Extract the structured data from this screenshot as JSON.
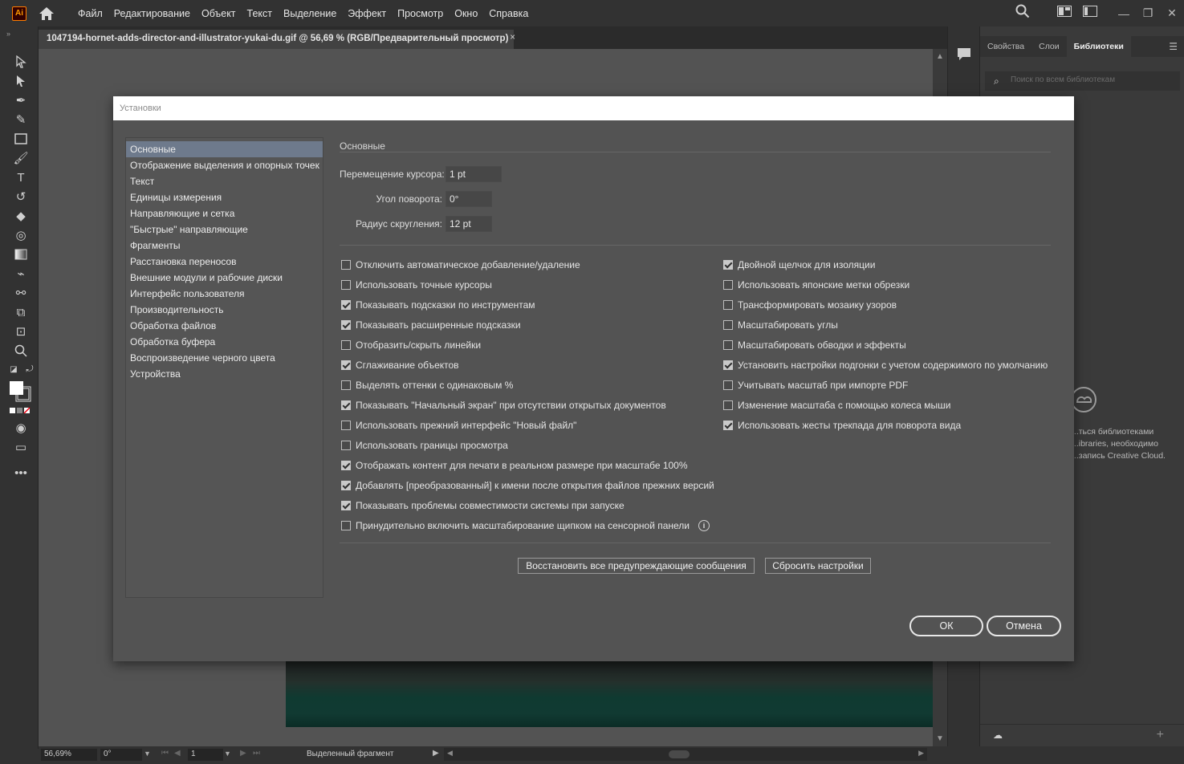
{
  "menubar": {
    "logo": "Ai",
    "items": [
      "Файл",
      "Редактирование",
      "Объект",
      "Текст",
      "Выделение",
      "Эффект",
      "Просмотр",
      "Окно",
      "Справка"
    ]
  },
  "document": {
    "tab_title": "1047194-hornet-adds-director-and-illustrator-yukai-du.gif @ 56,69 % (RGB/Предварительный просмотр)",
    "close": "×"
  },
  "right_panel": {
    "tabs": [
      "Свойства",
      "Слои",
      "Библиотеки"
    ],
    "active_tab": "Библиотеки",
    "search_placeholder": "Поиск по всем библиотекам",
    "message_lines": [
      "...ться библиотеками",
      "...ibraries, необходимо",
      "...запись Creative Cloud."
    ]
  },
  "statusbar": {
    "zoom": "56,69%",
    "rotation": "0°",
    "artboard": "1",
    "status_text": "Выделенный фрагмент"
  },
  "dialog": {
    "title": "Установки",
    "nav_items": [
      "Основные",
      "Отображение выделения и опорных точек",
      "Текст",
      "Единицы измерения",
      "Направляющие и сетка",
      "\"Быстрые\" направляющие",
      "Фрагменты",
      "Расстановка переносов",
      "Внешние модули и рабочие диски",
      "Интерфейс пользователя",
      "Производительность",
      "Обработка файлов",
      "Обработка буфера",
      "Воспроизведение черного цвета",
      "Устройства"
    ],
    "selected_nav": "Основные",
    "section_title": "Основные",
    "fields": {
      "keyboard_increment_label": "Перемещение курсора:",
      "keyboard_increment_value": "1 pt",
      "constrain_angle_label": "Угол поворота:",
      "constrain_angle_value": "0°",
      "corner_radius_label": "Радиус скругления:",
      "corner_radius_value": "12 pt"
    },
    "left_options": [
      {
        "label": "Отключить автоматическое добавление/удаление",
        "checked": false
      },
      {
        "label": "Использовать точные курсоры",
        "checked": false
      },
      {
        "label": "Показывать подсказки по инструментам",
        "checked": true
      },
      {
        "label": "Показывать расширенные подсказки",
        "checked": true
      },
      {
        "label": "Отобразить/скрыть линейки",
        "checked": false
      },
      {
        "label": "Сглаживание объектов",
        "checked": true
      },
      {
        "label": "Выделять оттенки с одинаковым %",
        "checked": false
      },
      {
        "label": "Показывать \"Начальный экран\" при отсутствии открытых документов",
        "checked": true
      },
      {
        "label": "Использовать прежний интерфейс \"Новый файл\"",
        "checked": false
      },
      {
        "label": "Использовать границы просмотра",
        "checked": false
      },
      {
        "label": "Отображать контент для печати в реальном размере при масштабе 100%",
        "checked": true
      },
      {
        "label": "Добавлять [преобразованный] к имени после открытия файлов прежних версий",
        "checked": true
      },
      {
        "label": "Показывать проблемы совместимости системы при запуске",
        "checked": true
      },
      {
        "label": "Принудительно включить масштабирование щипком на сенсорной панели",
        "checked": false
      }
    ],
    "right_options": [
      {
        "label": "Двойной щелчок для изоляции",
        "checked": true
      },
      {
        "label": "Использовать японские метки обрезки",
        "checked": false
      },
      {
        "label": "Трансформировать мозаику узоров",
        "checked": false
      },
      {
        "label": "Масштабировать углы",
        "checked": false
      },
      {
        "label": "Масштабировать обводки и эффекты",
        "checked": false
      },
      {
        "label": "Установить настройки подгонки с учетом содержимого по умолчанию",
        "checked": true
      },
      {
        "label": "Учитывать масштаб при импорте PDF",
        "checked": false
      },
      {
        "label": "Изменение масштаба с помощью колеса мыши",
        "checked": false
      },
      {
        "label": "Использовать жесты трекпада для поворота вида",
        "checked": true
      }
    ],
    "reset_warnings_label": "Восстановить все предупреждающие сообщения",
    "reset_prefs_label": "Сбросить настройки",
    "ok_label": "ОК",
    "cancel_label": "Отмена"
  }
}
